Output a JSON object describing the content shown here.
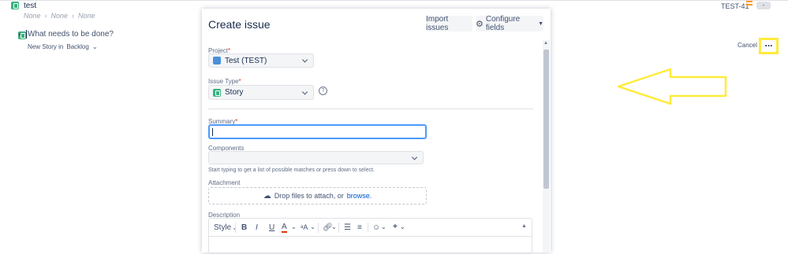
{
  "background_row": {
    "title": "test",
    "breadcrumbs": [
      "None",
      "None",
      "None"
    ],
    "issue_key": "TEST-41",
    "status_badge": "-"
  },
  "inline_create": {
    "placeholder": "What needs to be done?",
    "type_label": "New Story in",
    "location_label": "Backlog",
    "cancel_label": "Cancel",
    "more_label": "..."
  },
  "dialog": {
    "title": "Create issue",
    "import_button": "Import issues",
    "configure_button": "Configure fields",
    "project_label": "Project",
    "project_value": "Test (TEST)",
    "issue_type_label": "Issue Type",
    "issue_type_value": "Story",
    "summary_label": "Summary",
    "summary_value": "",
    "components_label": "Components",
    "components_hint": "Start typing to get a list of possible matches or press down to select.",
    "attachment_label": "Attachment",
    "drop_text": "Drop files to attach, or",
    "browse_link": "browse.",
    "description_label": "Description",
    "toolbar": {
      "style_label": "Style",
      "bold": "B",
      "italic": "I",
      "underline": "U",
      "text_color": "A",
      "text_size": "ᵃA"
    }
  },
  "colors": {
    "highlight": "#ffeb3b",
    "accent": "#0052cc",
    "story_green": "#36b37e"
  }
}
